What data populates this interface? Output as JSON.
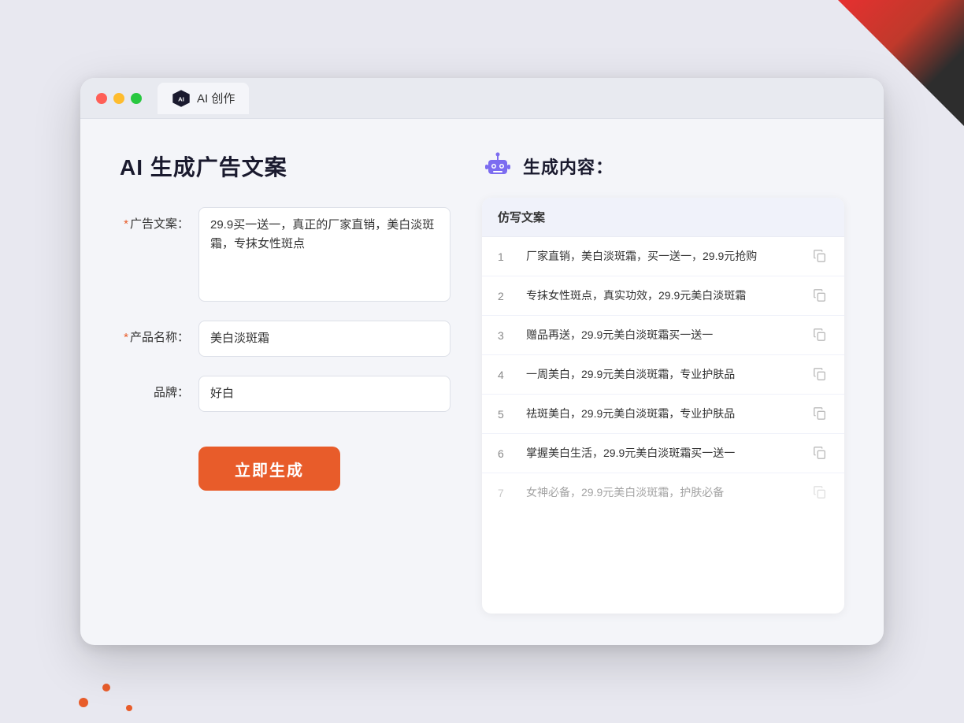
{
  "window": {
    "tab_title": "AI 创作"
  },
  "page": {
    "title": "AI 生成广告文案",
    "right_title": "生成内容："
  },
  "form": {
    "ad_copy_label": "广告文案：",
    "ad_copy_required": "*",
    "ad_copy_value": "29.9买一送一，真正的厂家直销，美白淡斑霜，专抹女性斑点",
    "product_name_label": "产品名称：",
    "product_name_required": "*",
    "product_name_value": "美白淡斑霜",
    "brand_label": "品牌：",
    "brand_value": "好白",
    "generate_btn": "立即生成"
  },
  "results": {
    "header": "仿写文案",
    "items": [
      {
        "num": "1",
        "text": "厂家直销，美白淡斑霜，买一送一，29.9元抢购",
        "dimmed": false
      },
      {
        "num": "2",
        "text": "专抹女性斑点，真实功效，29.9元美白淡斑霜",
        "dimmed": false
      },
      {
        "num": "3",
        "text": "赠品再送，29.9元美白淡斑霜买一送一",
        "dimmed": false
      },
      {
        "num": "4",
        "text": "一周美白，29.9元美白淡斑霜，专业护肤品",
        "dimmed": false
      },
      {
        "num": "5",
        "text": "祛斑美白，29.9元美白淡斑霜，专业护肤品",
        "dimmed": false
      },
      {
        "num": "6",
        "text": "掌握美白生活，29.9元美白淡斑霜买一送一",
        "dimmed": false
      },
      {
        "num": "7",
        "text": "女神必备，29.9元美白淡斑霜，护肤必备",
        "dimmed": true
      }
    ]
  }
}
